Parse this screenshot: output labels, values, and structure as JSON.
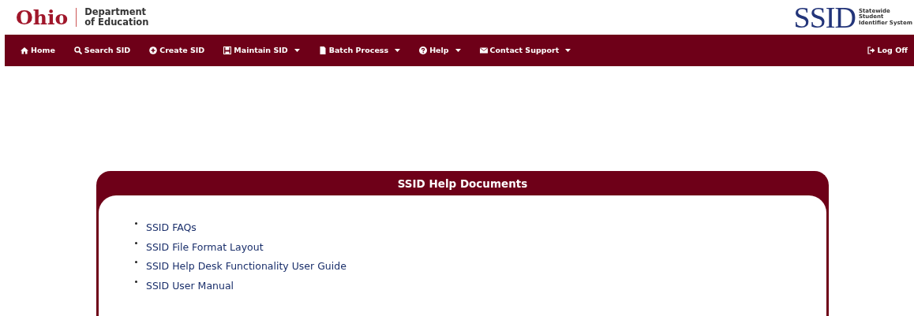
{
  "header": {
    "agency_logo": {
      "name": "Ohio",
      "line_1": "Department",
      "line_2": "of Education"
    },
    "system_logo": {
      "name": "SSID",
      "line_1": "Statewide",
      "line_2": "Student",
      "line_3": "Identifier System"
    }
  },
  "nav": {
    "items": [
      {
        "label": "Home",
        "dropdown": false
      },
      {
        "label": "Search SID",
        "dropdown": false
      },
      {
        "label": "Create SID",
        "dropdown": false
      },
      {
        "label": "Maintain SID",
        "dropdown": true
      },
      {
        "label": "Batch Process",
        "dropdown": true
      },
      {
        "label": "Help",
        "dropdown": true
      },
      {
        "label": "Contact Support",
        "dropdown": true
      }
    ],
    "right_items": [
      {
        "label": "Log Off",
        "dropdown": false
      }
    ]
  },
  "panel": {
    "title": "SSID Help Documents",
    "links": [
      "SSID FAQs",
      "SSID File Format Layout",
      "SSID Help Desk Functionality User Guide",
      "SSID User Manual"
    ]
  }
}
